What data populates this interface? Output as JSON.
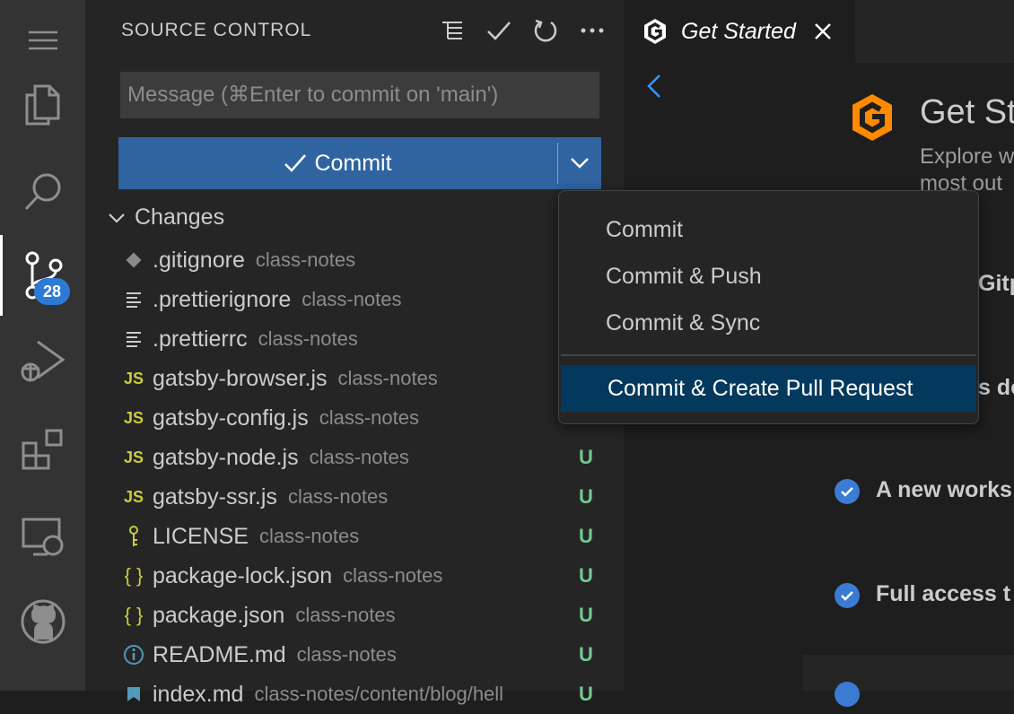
{
  "activity_bar": {
    "items": [
      "menu-icon",
      "explorer-icon",
      "search-icon",
      "source-control-icon",
      "run-debug-icon",
      "extensions-icon",
      "remote-explorer-icon",
      "github-icon"
    ],
    "source_control_badge": "28"
  },
  "sidebar": {
    "title": "SOURCE CONTROL",
    "actions": [
      "view-as-tree-icon",
      "commit-check-icon",
      "refresh-icon",
      "more-actions-icon"
    ],
    "message_placeholder": "Message (⌘Enter to commit on 'main')",
    "commit_label": "Commit",
    "changes_label": "Changes",
    "files": [
      {
        "icon": "git",
        "name": ".gitignore",
        "path": "class-notes",
        "status": ""
      },
      {
        "icon": "lines",
        "name": ".prettierignore",
        "path": "class-notes",
        "status": ""
      },
      {
        "icon": "lines",
        "name": ".prettierrc",
        "path": "class-notes",
        "status": ""
      },
      {
        "icon": "JS",
        "name": "gatsby-browser.js",
        "path": "class-notes",
        "status": ""
      },
      {
        "icon": "JS",
        "name": "gatsby-config.js",
        "path": "class-notes",
        "status": ""
      },
      {
        "icon": "JS",
        "name": "gatsby-node.js",
        "path": "class-notes",
        "status": "U"
      },
      {
        "icon": "JS",
        "name": "gatsby-ssr.js",
        "path": "class-notes",
        "status": "U"
      },
      {
        "icon": "key",
        "name": "LICENSE",
        "path": "class-notes",
        "status": "U"
      },
      {
        "icon": "braces",
        "name": "package-lock.json",
        "path": "class-notes",
        "status": "U"
      },
      {
        "icon": "braces",
        "name": "package.json",
        "path": "class-notes",
        "status": "U"
      },
      {
        "icon": "info",
        "name": "README.md",
        "path": "class-notes",
        "status": "U"
      },
      {
        "icon": "md",
        "name": "index.md",
        "path": "class-notes/content/blog/hell",
        "status": "U"
      }
    ]
  },
  "editor": {
    "tab_label": "Get Started",
    "welcome_title": "Get St",
    "welcome_sub_1": "Explore w",
    "welcome_sub_2": "most out",
    "partial_1": "Gitp",
    "partial_2": "s do",
    "check_1": "A new works",
    "check_2": "Full access t"
  },
  "commit_menu": {
    "items": [
      "Commit",
      "Commit & Push",
      "Commit & Sync"
    ],
    "selected": "Commit & Create Pull Request"
  },
  "colors": {
    "accent": "#2f64a0",
    "badge": "#2d7ad6",
    "untracked": "#73c991",
    "js": "#cbcb41",
    "menu_selected": "#04395e"
  }
}
